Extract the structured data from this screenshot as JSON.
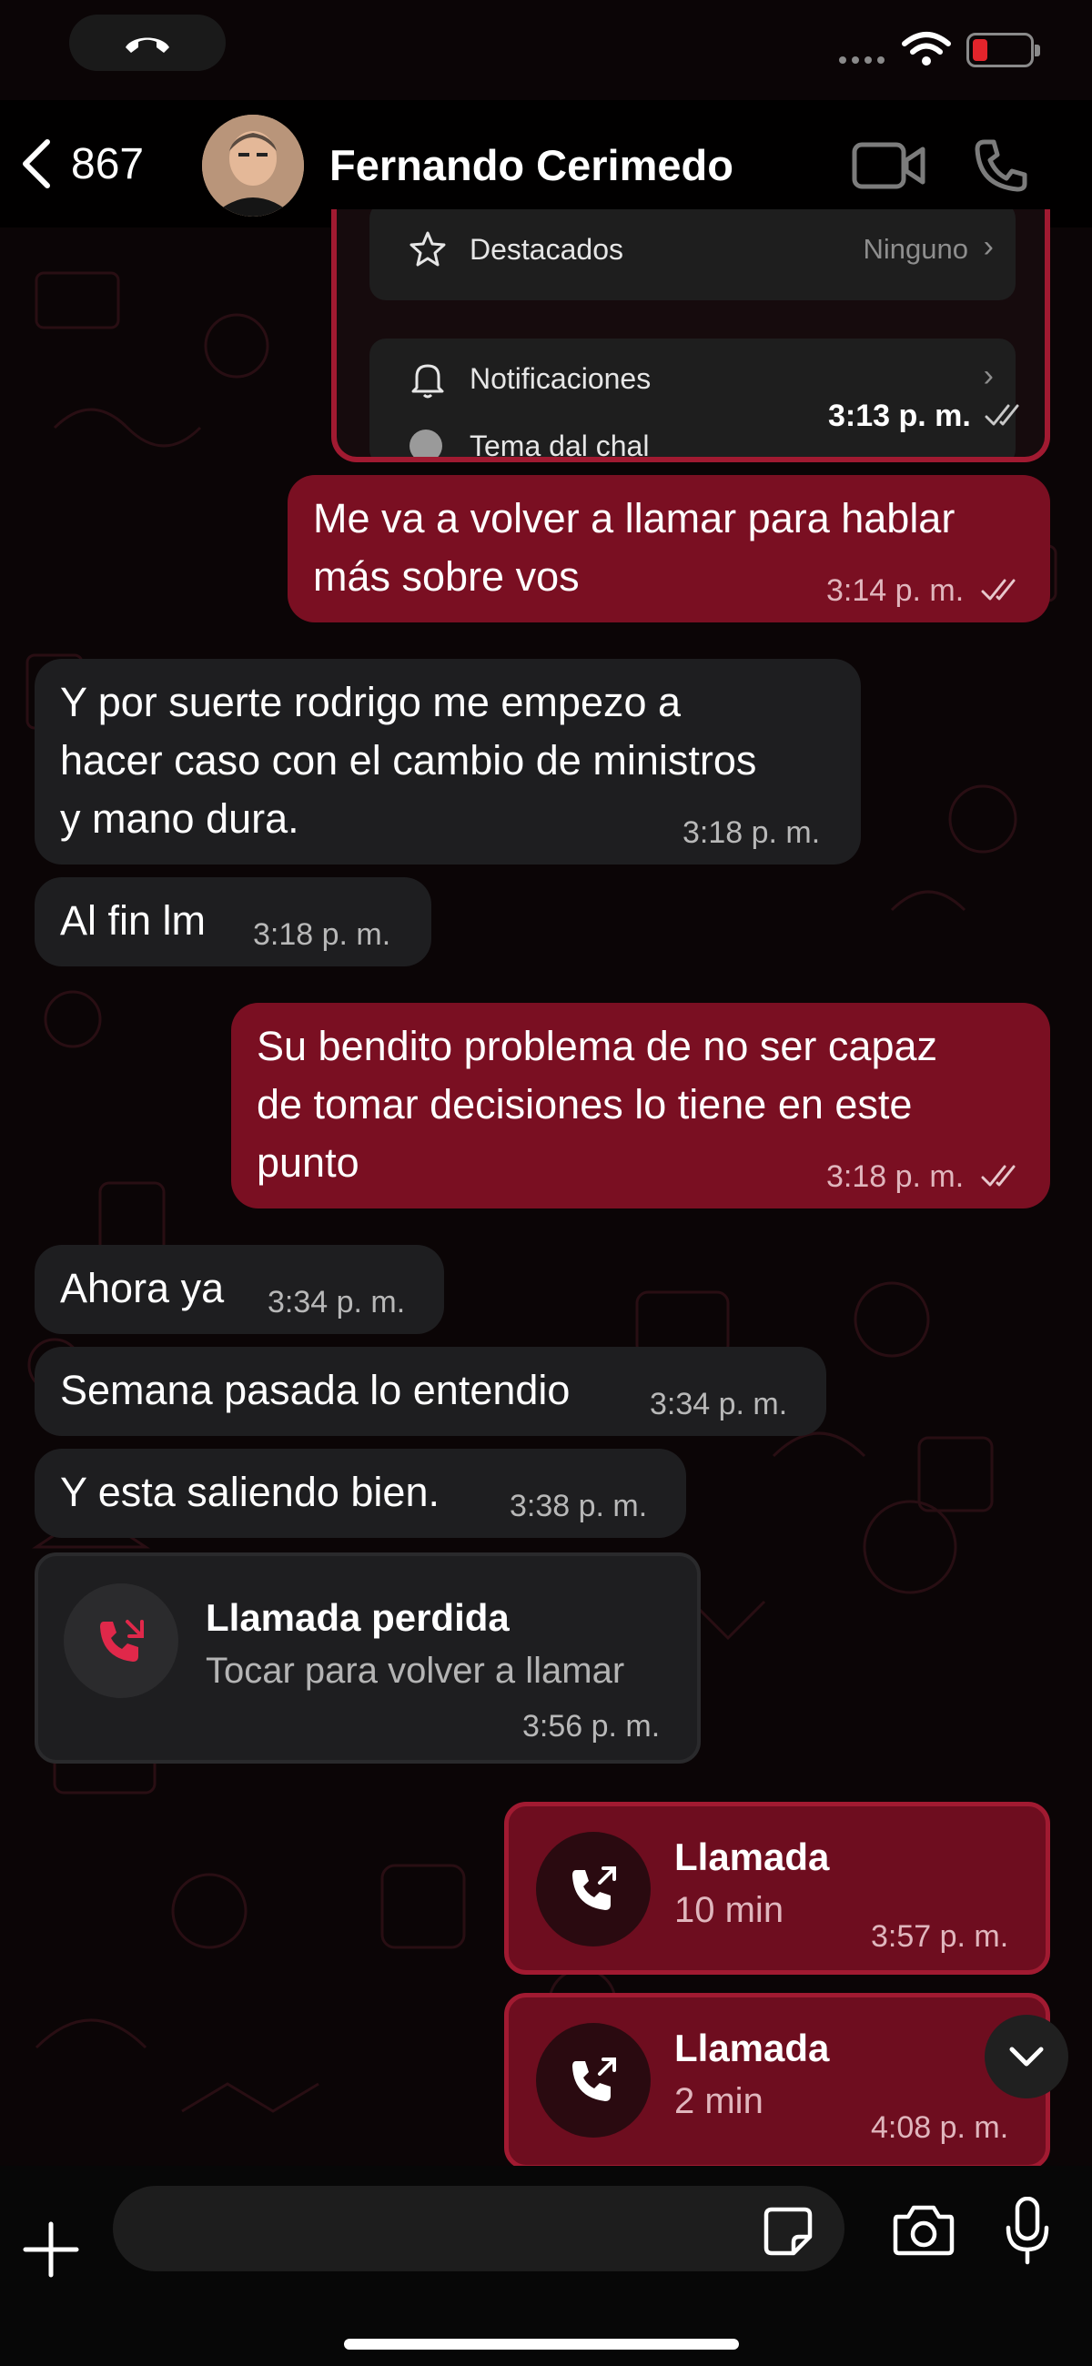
{
  "header": {
    "back_count": "867",
    "contact_name": "Fernando Cerimedo"
  },
  "quoted_screenshot": {
    "row1_label": "Destacados",
    "row1_value": "Ninguno",
    "row2_label": "Notificaciones",
    "row3_label": "Tema dal chal",
    "time": "3:13 p. m."
  },
  "messages": [
    {
      "dir": "out",
      "text": "Me va a volver a llamar para hablar\nmás sobre vos",
      "time": "3:14 p. m."
    },
    {
      "dir": "in",
      "text": "Y por suerte rodrigo me empezo a\nhacer caso con el cambio de ministros\ny mano dura.",
      "time": "3:18 p. m."
    },
    {
      "dir": "in",
      "text": "Al fin lm",
      "time": "3:18 p. m."
    },
    {
      "dir": "out",
      "text": "Su bendito problema de no ser capaz\nde tomar decisiones lo tiene en este\npunto",
      "time": "3:18 p. m."
    },
    {
      "dir": "in",
      "text": "Ahora ya",
      "time": "3:34 p. m."
    },
    {
      "dir": "in",
      "text": "Semana pasada lo entendio",
      "time": "3:34 p. m."
    },
    {
      "dir": "in",
      "text": "Y esta saliendo bien.",
      "time": "3:38 p. m."
    }
  ],
  "missed_call": {
    "title": "Llamada perdida",
    "subtitle": "Tocar para volver a llamar",
    "time": "3:56 p. m."
  },
  "calls": [
    {
      "title": "Llamada",
      "duration": "10 min",
      "time": "3:57 p. m."
    },
    {
      "title": "Llamada",
      "duration": "2 min",
      "time": "4:08 p. m."
    }
  ],
  "composer": {
    "placeholder": ""
  },
  "colors": {
    "outgoing_bubble": "#7a0f22",
    "incoming_bubble": "#1e1e20",
    "accent_border": "#a11a31",
    "missed_call_icon": "#e0284a"
  },
  "icons": [
    "back-chevron-icon",
    "video-call-icon",
    "phone-icon",
    "star-icon",
    "bell-icon",
    "missed-call-icon",
    "outgoing-call-icon",
    "chevron-down-icon",
    "plus-icon",
    "sticker-icon",
    "camera-icon",
    "microphone-icon",
    "wifi-icon",
    "battery-icon"
  ]
}
